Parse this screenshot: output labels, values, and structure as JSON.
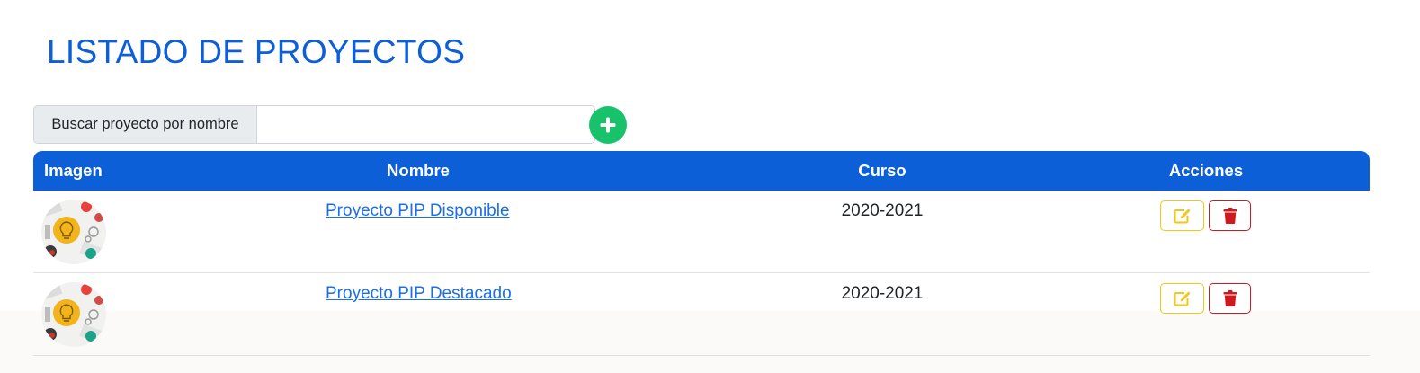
{
  "page": {
    "title": "LISTADO DE PROYECTOS"
  },
  "search": {
    "label": "Buscar proyecto por nombre",
    "value": "",
    "placeholder": ""
  },
  "add_button": {
    "icon": "plus-icon",
    "color": "#17c26b"
  },
  "table": {
    "header_color": "#0d5fd8",
    "columns": [
      "Imagen",
      "Nombre",
      "Curso",
      "Acciones"
    ],
    "rows": [
      {
        "image_icon": "project-thumbnail",
        "name": "Proyecto PIP Disponible",
        "curso": "2020-2021"
      },
      {
        "image_icon": "project-thumbnail",
        "name": "Proyecto PIP Destacado",
        "curso": "2020-2021"
      }
    ]
  },
  "actions": {
    "edit_icon": "edit-icon",
    "edit_color": "#f5c518",
    "delete_icon": "trash-icon",
    "delete_color": "#d0191f"
  }
}
